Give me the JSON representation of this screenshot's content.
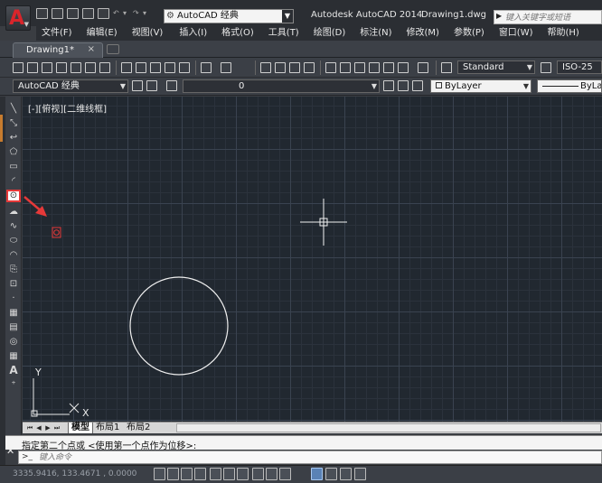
{
  "title_bar": {
    "workspace": "AutoCAD 经典",
    "app_title": "Autodesk AutoCAD 2014",
    "document_title": "Drawing1.dwg",
    "search_placeholder": "键入关键字或短语"
  },
  "menu": [
    "文件(F)",
    "编辑(E)",
    "视图(V)",
    "插入(I)",
    "格式(O)",
    "工具(T)",
    "绘图(D)",
    "标注(N)",
    "修改(M)",
    "参数(P)",
    "窗口(W)",
    "帮助(H)"
  ],
  "tabs": {
    "document_tab": "Drawing1*",
    "close_glyph": "×"
  },
  "toolbar": {
    "text_style": "Standard",
    "dim_style": "ISO-25",
    "workspace_combo": "AutoCAD 经典",
    "layer": "0",
    "color": "ByLayer",
    "linetype": "ByLa"
  },
  "canvas": {
    "view_label": "[-][俯视][二维线框]",
    "ucs_y": "Y",
    "ucs_x": "X",
    "background_color": "#212830"
  },
  "layout_tabs": [
    "模型",
    "布局1",
    "布局2"
  ],
  "command_line": {
    "history": "指定第二个点或 <使用第一个点作为位移>:",
    "placeholder": "键入命令"
  },
  "status": {
    "coordinates": "3335.9416, 133.4671 , 0.0000"
  },
  "highlight": {
    "color": "#e53939",
    "tool": "circle-tool"
  },
  "icons": {
    "app": "autocad-logo-icon",
    "gear": "gear-icon",
    "close": "close-icon",
    "arrow": "red-arrow-icon"
  }
}
